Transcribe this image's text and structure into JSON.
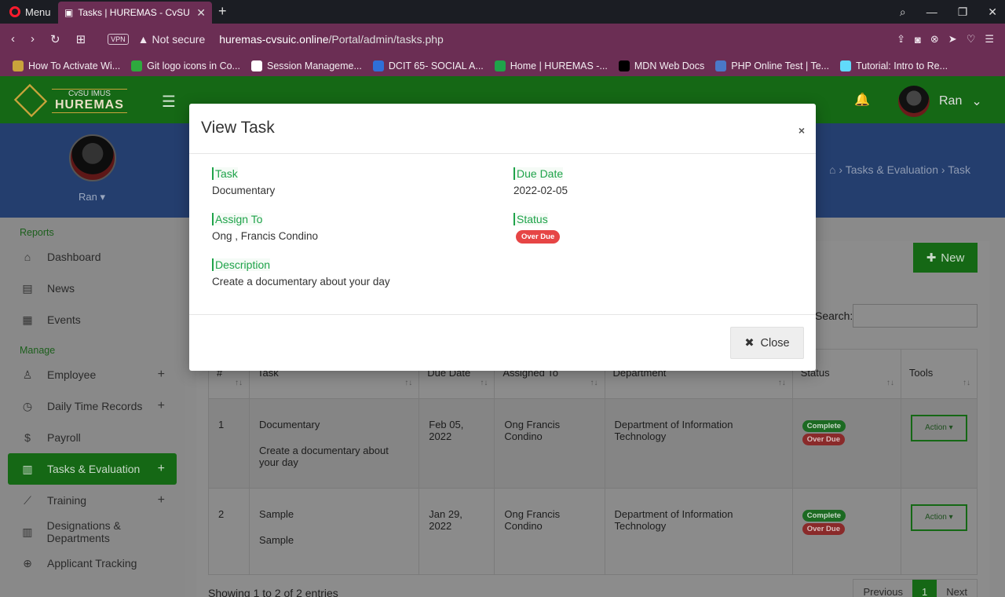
{
  "browser": {
    "menu_label": "Menu",
    "tab_title": "Tasks | HUREMAS - CvSU Im",
    "vpn_label": "VPN",
    "security_label": "Not secure",
    "url_host": "huremas-cvsuic.online",
    "url_path": "/Portal/admin/tasks.php",
    "bookmarks": [
      {
        "label": "How To Activate Wi...",
        "color": "#c9a43b"
      },
      {
        "label": "Git logo icons in Co...",
        "color": "#2eaa3e"
      },
      {
        "label": "Session Manageme...",
        "color": "#ffffff"
      },
      {
        "label": "DCIT 65- SOCIAL A...",
        "color": "#2f6fd8"
      },
      {
        "label": "Home | HUREMAS -...",
        "color": "#1fa34a"
      },
      {
        "label": "MDN Web Docs",
        "color": "#000000"
      },
      {
        "label": "PHP Online Test | Te...",
        "color": "#4a78c8"
      },
      {
        "label": "Tutorial: Intro to Re...",
        "color": "#61dafb"
      }
    ]
  },
  "app": {
    "logo_small": "CvSU IMUS",
    "logo_big": "HUREMAS",
    "user_name": "Ran",
    "sidebar": {
      "user_name": "Ran",
      "sections": {
        "reports": "Reports",
        "manage": "Manage"
      },
      "reports_items": [
        {
          "label": "Dashboard",
          "icon": "home-icon"
        },
        {
          "label": "News",
          "icon": "news-icon"
        },
        {
          "label": "Events",
          "icon": "calendar-icon"
        }
      ],
      "manage_items": [
        {
          "label": "Employee",
          "icon": "user-icon",
          "expandable": true
        },
        {
          "label": "Daily Time Records",
          "icon": "clock-icon",
          "expandable": true
        },
        {
          "label": "Payroll",
          "icon": "dollar-icon",
          "expandable": false
        },
        {
          "label": "Tasks & Evaluation",
          "icon": "chart-icon",
          "expandable": true,
          "active": true
        },
        {
          "label": "Training",
          "icon": "trend-icon",
          "expandable": true
        },
        {
          "label": "Designations & Departments",
          "icon": "columns-icon",
          "expandable": false
        },
        {
          "label": "Applicant Tracking",
          "icon": "target-icon",
          "expandable": false
        }
      ]
    },
    "breadcrumb": {
      "section": "Tasks & Evaluation",
      "page": "Task"
    },
    "new_button": "New",
    "search_label": "Search:",
    "table": {
      "headers": [
        "#",
        "Task",
        "Due Date",
        "Assigned To",
        "Department",
        "Status",
        "Tools"
      ],
      "rows": [
        {
          "num": "1",
          "task": "Documentary",
          "description": "Create a documentary about your day",
          "due": "Feb 05, 2022",
          "assigned": "Ong Francis Condino",
          "department": "Department of Information Technology",
          "status_a": "Complete",
          "status_b": "Over Due",
          "action": "Action"
        },
        {
          "num": "2",
          "task": "Sample",
          "description": "Sample",
          "due": "Jan 29, 2022",
          "assigned": "Ong Francis Condino",
          "department": "Department of Information Technology",
          "status_a": "Complete",
          "status_b": "Over Due",
          "action": "Action"
        }
      ]
    },
    "footer": {
      "showing": "Showing 1 to 2 of 2 entries",
      "prev": "Previous",
      "page": "1",
      "next": "Next"
    }
  },
  "modal": {
    "title": "View Task",
    "close_x": "×",
    "task_label": "Task",
    "task_value": "Documentary",
    "due_label": "Due Date",
    "due_value": "2022-02-05",
    "assign_label": "Assign To",
    "assign_value": "Ong , Francis Condino",
    "status_label": "Status",
    "status_value": "Over Due",
    "desc_label": "Description",
    "desc_value": "Create a documentary about your day",
    "close_button": "Close"
  }
}
